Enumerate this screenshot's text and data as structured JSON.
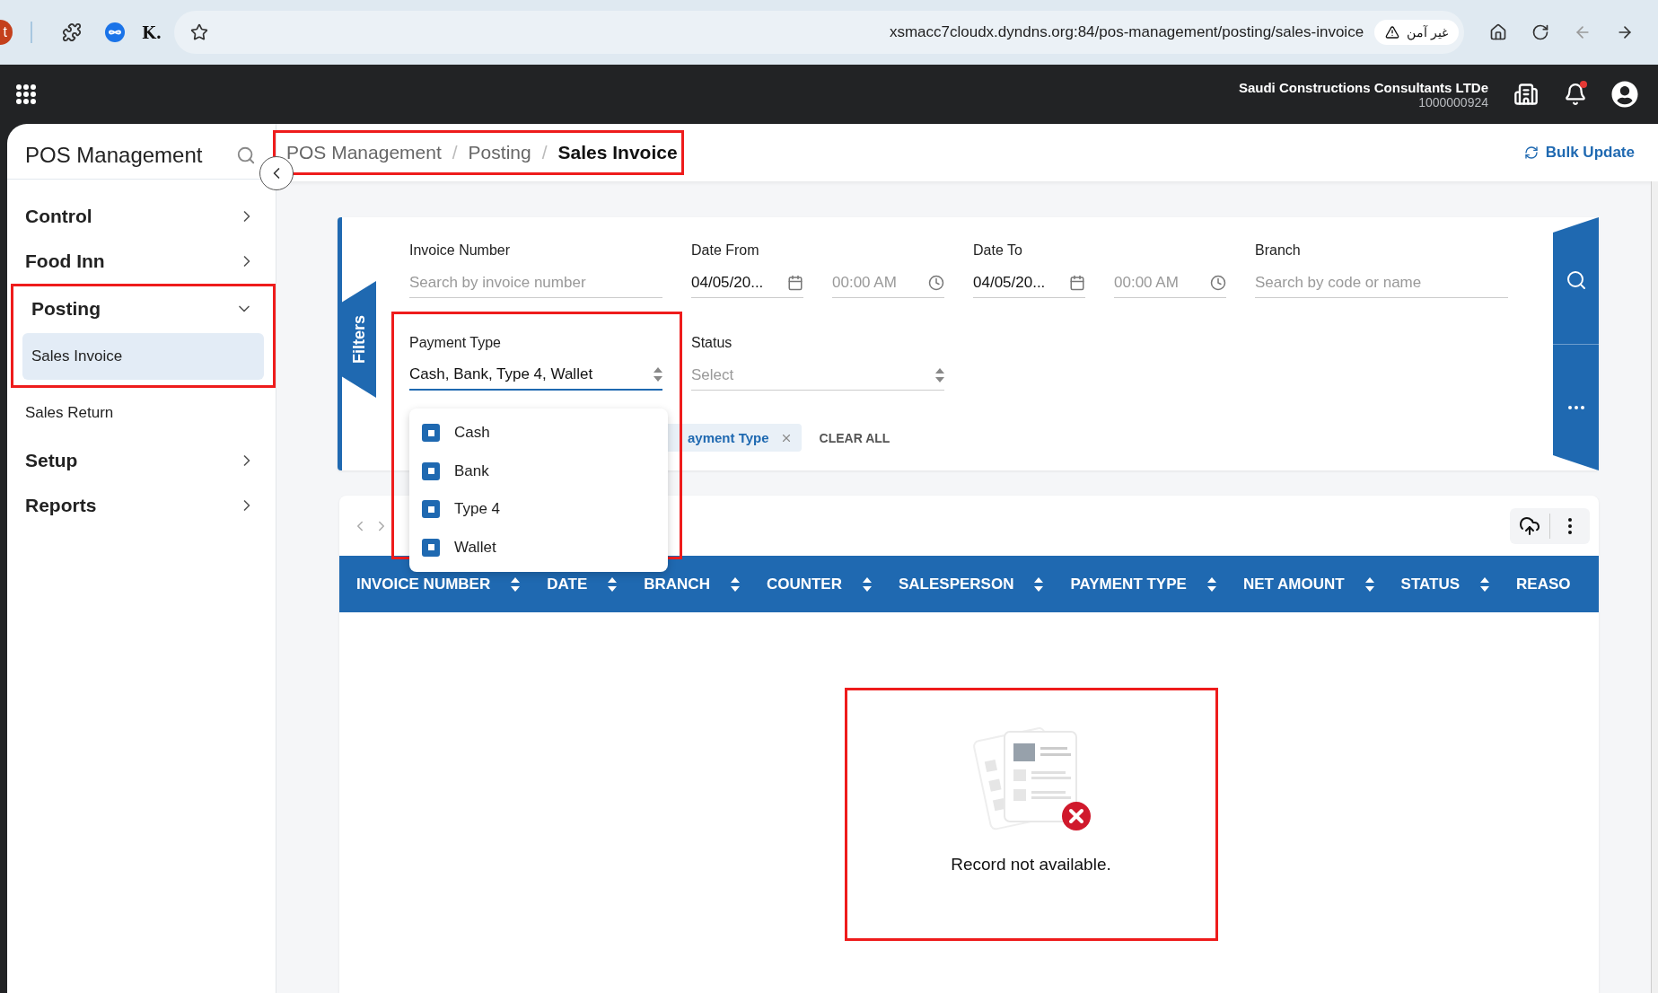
{
  "browser": {
    "profile_initial": "t",
    "extension_label": "K.",
    "address": "xsmacc7cloudx.dyndns.org:84/pos-management/posting/sales-invoice",
    "security_badge": "غير آمن"
  },
  "header": {
    "company": "Saudi Constructions Consultants LTDe",
    "company_code": "1000000924",
    "has_notification": true
  },
  "sidebar": {
    "title": "POS Management",
    "items": [
      {
        "label": "Control",
        "expanded": false
      },
      {
        "label": "Food Inn",
        "expanded": false
      },
      {
        "label": "Posting",
        "expanded": true,
        "children": [
          {
            "label": "Sales Invoice",
            "selected": true
          },
          {
            "label": "Sales Return",
            "selected": false
          }
        ]
      },
      {
        "label": "Setup",
        "expanded": false
      },
      {
        "label": "Reports",
        "expanded": false
      }
    ]
  },
  "breadcrumb": {
    "items": [
      "POS Management",
      "Posting",
      "Sales Invoice"
    ],
    "separators": [
      "/",
      "/"
    ]
  },
  "bulk_update": "Bulk Update",
  "filters": {
    "tab_label": "Filters",
    "fields": [
      {
        "kind": "text",
        "label": "Invoice Number",
        "placeholder": "Search by invoice number"
      },
      {
        "kind": "datetime",
        "label": "Date From",
        "value": "04/05/20...",
        "time_placeholder": "00:00 AM"
      },
      {
        "kind": "datetime",
        "label": "Date To",
        "value": "04/05/20...",
        "time_placeholder": "00:00 AM"
      },
      {
        "kind": "text",
        "label": "Branch",
        "placeholder": "Search by code or name"
      },
      {
        "kind": "select",
        "label": "Payment Type",
        "value": "Cash, Bank, Type 4, Wallet",
        "open": true,
        "options": [
          {
            "label": "Cash",
            "checked": true
          },
          {
            "label": "Bank",
            "checked": true
          },
          {
            "label": "Type 4",
            "checked": true
          },
          {
            "label": "Wallet",
            "checked": true
          }
        ]
      },
      {
        "kind": "select",
        "label": "Status",
        "placeholder": "Select",
        "open": false
      }
    ],
    "chips": [
      {
        "label": "ayment Type"
      }
    ],
    "clear_all": "CLEAR ALL"
  },
  "table": {
    "columns": [
      "INVOICE NUMBER",
      "DATE",
      "BRANCH",
      "COUNTER",
      "SALESPERSON",
      "PAYMENT TYPE",
      "NET AMOUNT",
      "STATUS",
      "REASO"
    ],
    "empty_message": "Record not available."
  }
}
